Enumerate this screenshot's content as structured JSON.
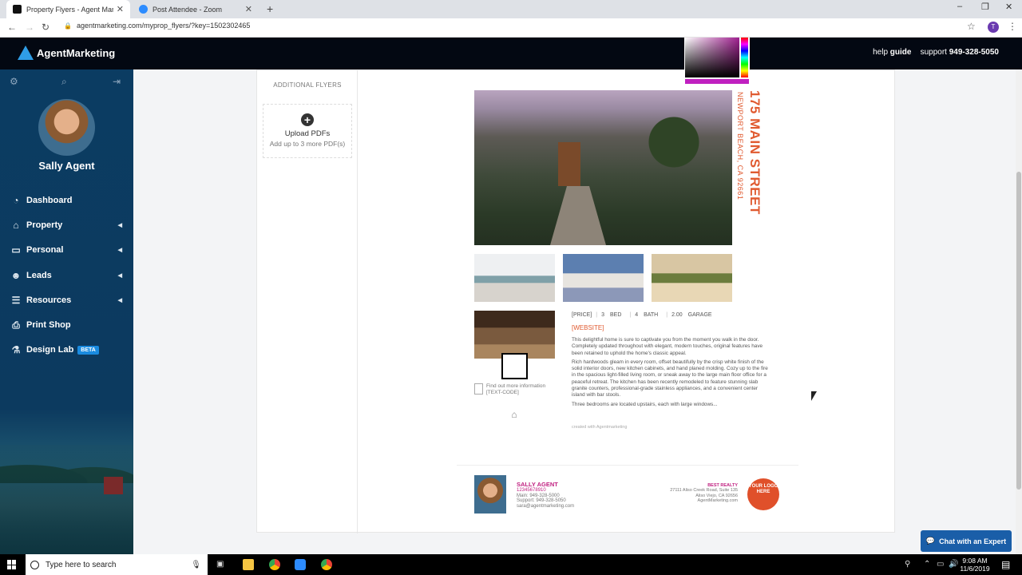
{
  "browser": {
    "tabs": [
      {
        "title": "Property Flyers - Agent Marketin",
        "active": true
      },
      {
        "title": "Post Attendee - Zoom",
        "active": false
      }
    ],
    "new_tab": "+",
    "url": "agentmarketing.com/myprop_flyers/?key=1502302465",
    "profile_initial": "T"
  },
  "header": {
    "logo_text": "AgentMarketing",
    "help_label": "help",
    "guide_label": "guide",
    "support_label": "support",
    "support_phone": "949-328-5050"
  },
  "sidebar": {
    "user_name": "Sally Agent",
    "items": [
      {
        "label": "Dashboard",
        "icon": "dashboard-icon",
        "expandable": false
      },
      {
        "label": "Property",
        "icon": "house-icon",
        "expandable": true
      },
      {
        "label": "Personal",
        "icon": "camera-icon",
        "expandable": true
      },
      {
        "label": "Leads",
        "icon": "users-icon",
        "expandable": true
      },
      {
        "label": "Resources",
        "icon": "list-icon",
        "expandable": true
      },
      {
        "label": "Print Shop",
        "icon": "printer-icon",
        "expandable": false
      },
      {
        "label": "Design Lab",
        "icon": "flask-icon",
        "expandable": false,
        "badge": "BETA"
      }
    ]
  },
  "additional_flyers": {
    "heading": "ADDITIONAL FLYERS",
    "upload_title": "Upload PDFs",
    "upload_sub": "Add up to 3 more PDF(s)"
  },
  "flyer": {
    "street": "175 MAIN STREET",
    "city": "NEWPORT BEACH, CA 92661",
    "price": "[PRICE]",
    "beds": "3",
    "beds_label": "BED",
    "baths": "4",
    "baths_label": "BATH",
    "garage": "2.00",
    "garage_label": "GARAGE",
    "website": "[WEBSITE]",
    "paragraphs": [
      "This delightful home is sure to captivate you from the moment you walk in the door. Completely updated throughout with elegant, modern touches, original features have been retained to uphold the home's classic appeal.",
      "Rich hardwoods gleam in every room, offset beautifully by the crisp white finish of the solid interior doors, new kitchen cabinets, and hand planed molding. Cozy up to the fire in the spacious light-filled living room, or sneak away to the large main floor office for a peaceful retreat. The kitchen has been recently remodeled to feature stunning slab granite counters, professional-grade stainless appliances, and a convenient center island with bar stools.",
      "Three bedrooms are located upstairs, each with large windows..."
    ],
    "find_info": "Find out more information",
    "text_code": "[TEXT-CODE]",
    "created_with": "created with Agentmarketing",
    "agent_name": "SALLY AGENT",
    "agent_license": "12345678910",
    "agent_main": "Main: 949-328-5000",
    "agent_support": "Support: 949-328-5050",
    "agent_email": "sara@agentmarketing.com",
    "broker_name": "BEST REALTY",
    "broker_addr1": "27111 Aliso Creek Road, Suite 135",
    "broker_addr2": "Aliso Viejo, CA 92656",
    "broker_web": "AgentMarketing.com",
    "logo_placeholder": "YOUR LOGO HERE"
  },
  "chat": {
    "label": "Chat with an Expert"
  },
  "taskbar": {
    "search_placeholder": "Type here to search",
    "time": "9:08 AM",
    "date": "11/6/2019"
  },
  "colors": {
    "accent": "#e05a30",
    "header_bg": "#030812",
    "sidebar_bg": "#0b3c62",
    "chat_bg": "#1a5ea8",
    "agent_pink": "#c02080"
  }
}
